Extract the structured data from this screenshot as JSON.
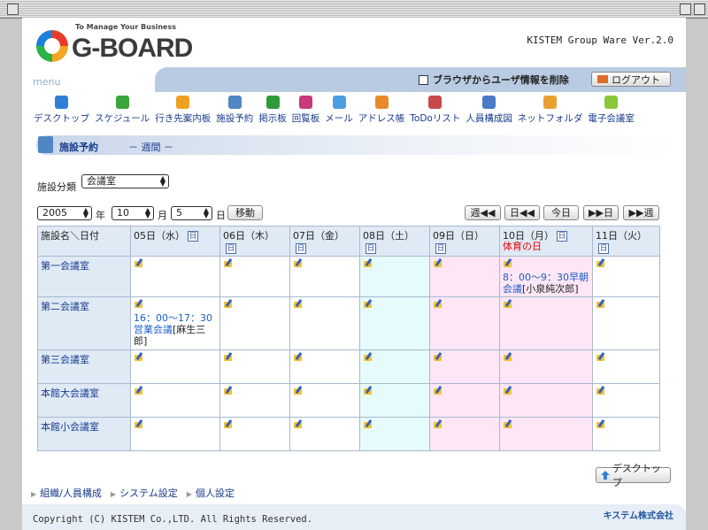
{
  "header": {
    "tagline": "To Manage Your Business",
    "logo_text": "G-BOARD",
    "version": "KISTEM Group Ware Ver.2.0"
  },
  "menubar": {
    "label": "menu",
    "clear_label": "ブラウザからユーザ情報を削除",
    "logout_label": "ログアウト"
  },
  "nav": [
    {
      "label": "デスクトップ",
      "icon": "arrow-up-icon",
      "color": "#2f7fd8"
    },
    {
      "label": "スケジュール",
      "icon": "alarm-clock-icon",
      "color": "#3aa53a"
    },
    {
      "label": "行き先案内板",
      "icon": "arrow-right-icon",
      "color": "#f0a020"
    },
    {
      "label": "施設予約",
      "icon": "building-icon",
      "color": "#4f86c4"
    },
    {
      "label": "掲示板",
      "icon": "board-icon",
      "color": "#2f9a3a"
    },
    {
      "label": "回覧板",
      "icon": "checklist-icon",
      "color": "#c83a7a"
    },
    {
      "label": "メール",
      "icon": "mail-icon",
      "color": "#4aa0e0"
    },
    {
      "label": "アドレス帳",
      "icon": "address-book-icon",
      "color": "#e88a2a"
    },
    {
      "label": "ToDoリスト",
      "icon": "todo-icon",
      "color": "#c84a4a"
    },
    {
      "label": "人員構成図",
      "icon": "people-icon",
      "color": "#4a7ac8"
    },
    {
      "label": "ネットフォルダ",
      "icon": "folder-icon",
      "color": "#e8a030"
    },
    {
      "label": "電子会議室",
      "icon": "chat-icon",
      "color": "#8ac83a"
    }
  ],
  "section": {
    "title": "施設予約",
    "subtitle": "－ 週間 －"
  },
  "filter": {
    "label": "施設分類",
    "value": "会議室"
  },
  "date_nav": {
    "year": "2005",
    "year_label": "年",
    "month": "10",
    "month_label": "月",
    "day": "5",
    "day_label": "日",
    "move_label": "移動",
    "prev_week": "週◀◀",
    "prev_day": "日◀◀",
    "today": "今日",
    "next_day": "▶▶日",
    "next_week": "▶▶週"
  },
  "table": {
    "corner": "施設名＼日付",
    "day_icon_label": "日",
    "days": [
      {
        "label": "05日（水）",
        "kind": "weekday"
      },
      {
        "label": "06日（木）",
        "kind": "weekday"
      },
      {
        "label": "07日（金）",
        "kind": "weekday"
      },
      {
        "label": "08日（土）",
        "kind": "sat"
      },
      {
        "label": "09日（日）",
        "kind": "sun"
      },
      {
        "label": "10日（月）",
        "kind": "hol",
        "holiday": "体育の日"
      },
      {
        "label": "11日（火）",
        "kind": "weekday"
      }
    ],
    "rooms": [
      {
        "name": "第一会議室",
        "events": {
          "5": {
            "time": "8：00～9：30",
            "title": "早朝会議",
            "owner": "[小泉純次郎]"
          }
        }
      },
      {
        "name": "第二会議室",
        "events": {
          "0": {
            "time": "16：00～17：30",
            "title": "営業会議",
            "owner": "[麻生三郎]"
          }
        }
      },
      {
        "name": "第三会議室",
        "events": {}
      },
      {
        "name": "本館大会議室",
        "events": {}
      },
      {
        "name": "本館小会議室",
        "events": {}
      }
    ]
  },
  "desktop_button": "デスクトップ",
  "footer_links": [
    "組織/人員構成",
    "システム設定",
    "個人設定"
  ],
  "copyright": "Copyright (C) KISTEM Co.,LTD. All Rights Reserved.",
  "company": "キステム株式会社"
}
